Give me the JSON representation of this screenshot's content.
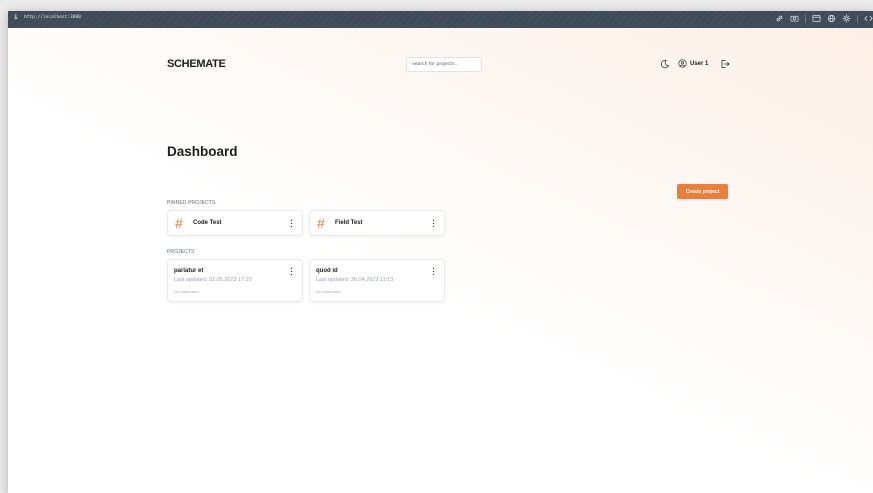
{
  "titlebar": {
    "info": "i",
    "url": "http://localhost:3000",
    "icons": [
      "link-icon",
      "camera-icon",
      "window-icon",
      "globe-icon",
      "gear-icon",
      "code-icon"
    ]
  },
  "header": {
    "logo": "SCHEMATE",
    "search_placeholder": "Search for projects...",
    "theme_icon": "moon-icon",
    "user_icon": "user-circle-icon",
    "user_name": "User 1",
    "logout_icon": "logout-icon"
  },
  "main": {
    "title": "Dashboard",
    "create_button": "Create project",
    "pinned_label": "PINNED PROJECTS",
    "pinned": [
      {
        "hash": "#",
        "name": "Code Test"
      },
      {
        "hash": "#",
        "name": "Field Test"
      }
    ],
    "projects_label": "PROJECTS",
    "projects": [
      {
        "name": "pariatur et",
        "updated": "Last updated: 02.05.2023 17:10",
        "collab": "No collaboration"
      },
      {
        "name": "quod id",
        "updated": "Last updated: 30.04.2023 11:13",
        "collab": "No collaboration"
      }
    ]
  },
  "colors": {
    "accent": "#e97f3c",
    "titlebar": "#3e4a56",
    "text": "#1d1d1f",
    "muted": "#9aa3ad"
  }
}
